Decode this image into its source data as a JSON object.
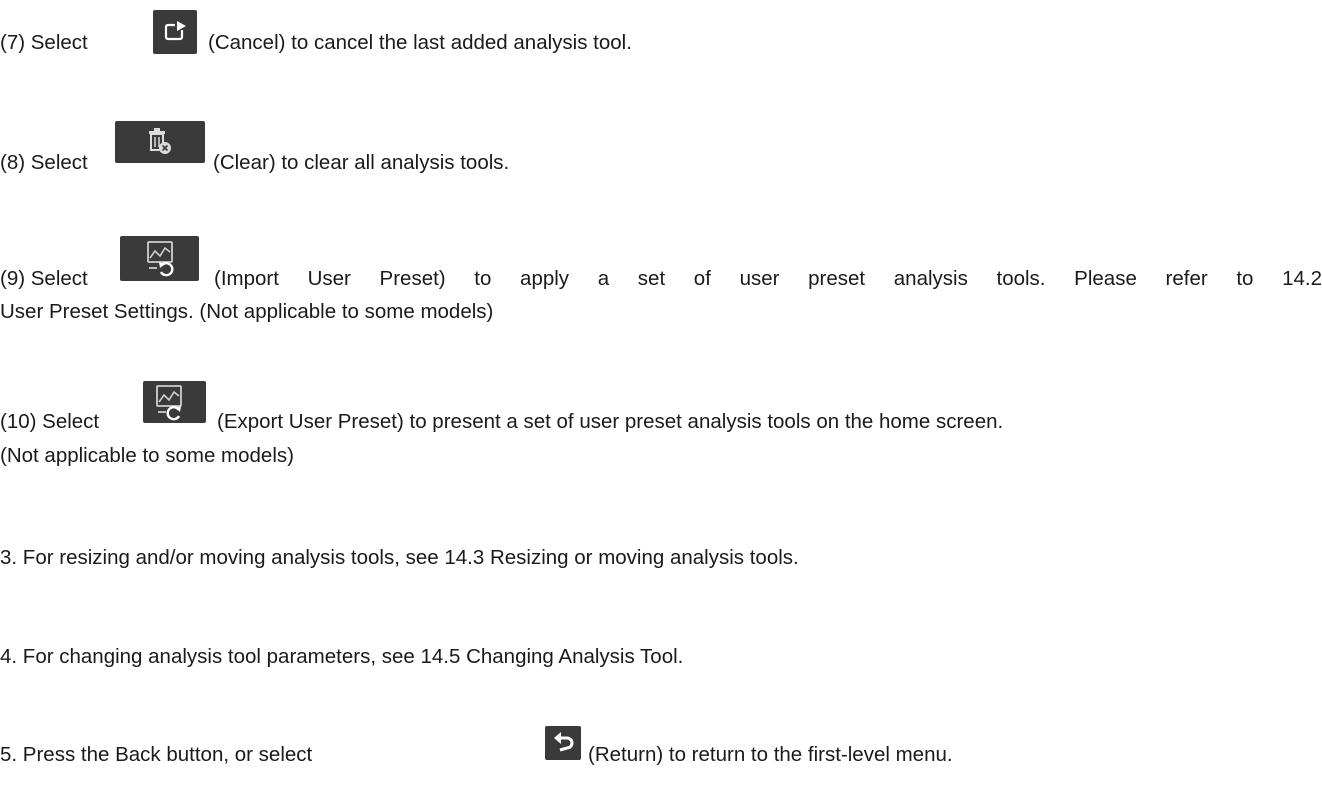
{
  "items": [
    {
      "prefix": "(7) Select",
      "icon": "cancel-icon",
      "text": "(Cancel) to cancel the last added analysis tool."
    },
    {
      "prefix": "(8) Select",
      "icon": "clear-icon",
      "text": "(Clear) to clear all analysis tools."
    },
    {
      "prefix": "(9) Select",
      "icon": "import-user-preset-icon",
      "text": "(Import User Preset) to apply a set of user preset analysis tools. Please refer to 14.2",
      "continuation": "User Preset Settings. (Not applicable to some models)"
    },
    {
      "prefix": "(10) Select",
      "icon": "export-user-preset-icon",
      "text": "(Export User Preset) to present a set of user preset analysis tools on the home screen.",
      "continuation": "(Not applicable to some models)"
    }
  ],
  "steps": [
    "3. For resizing and/or moving analysis tools, see 14.3 Resizing or moving analysis tools.",
    "4. For changing analysis tool parameters, see 14.5 Changing Analysis Tool."
  ],
  "step5": {
    "prefix": "5. Press the Back button, or select",
    "icon": "return-icon",
    "text": "(Return) to return to the first-level menu."
  }
}
